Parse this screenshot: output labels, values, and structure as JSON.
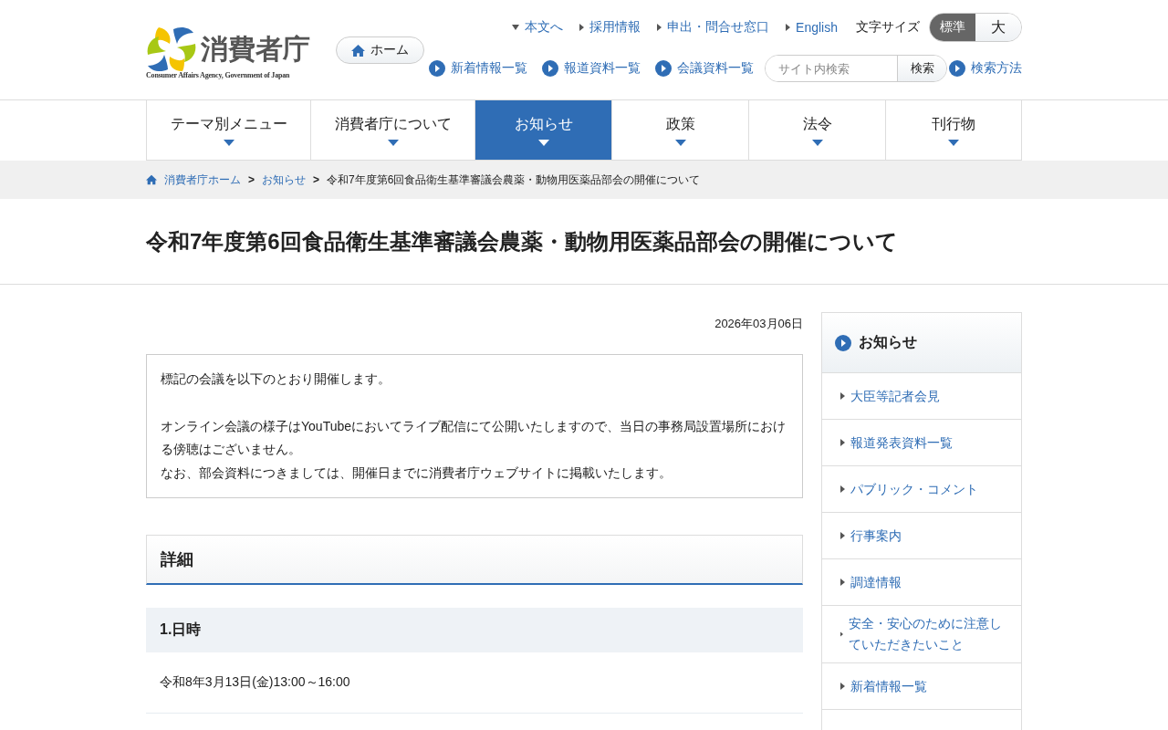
{
  "header": {
    "logo": {
      "name": "消費者庁",
      "subtitle": "Consumer Affairs Agency, Government of Japan"
    },
    "home_button": "ホーム",
    "utility_links": [
      {
        "label": "本文へ",
        "kind": "down"
      },
      {
        "label": "採用情報",
        "kind": "right"
      },
      {
        "label": "申出・問合せ窓口",
        "kind": "right"
      },
      {
        "label": "English",
        "kind": "right"
      }
    ],
    "font_size": {
      "label": "文字サイズ",
      "options": [
        {
          "label": "標準",
          "selected": true
        },
        {
          "label": "大",
          "selected": false
        }
      ]
    },
    "quick_links": [
      "新着情報一覧",
      "報道資料一覧",
      "会議資料一覧"
    ],
    "search": {
      "placeholder": "サイト内検索",
      "button": "検索"
    },
    "search_help": "検索方法"
  },
  "nav": [
    {
      "label": "テーマ別メニュー",
      "selected": false
    },
    {
      "label": "消費者庁について",
      "selected": false
    },
    {
      "label": "お知らせ",
      "selected": true
    },
    {
      "label": "政策",
      "selected": false
    },
    {
      "label": "法令",
      "selected": false
    },
    {
      "label": "刊行物",
      "selected": false
    }
  ],
  "breadcrumb": {
    "separator": ">",
    "links": [
      "消費者庁ホーム",
      "お知らせ"
    ],
    "current": "令和7年度第6回食品衛生基準審議会農薬・動物用医薬品部会の開催について"
  },
  "title": "令和7年度第6回食品衛生基準審議会農薬・動物用医薬品部会の開催について",
  "date": "2026年03月06日",
  "notice": [
    [
      "標記の会議を以下のとおり開催します。"
    ],
    [
      "オンライン会議の様子はYouTubeにおいてライブ配信にて公開いたしますので、当日の事務局設置場所における傍聴はございません。",
      "なお、部会資料につきましては、開催日までに消費者庁ウェブサイトに掲載いたします。"
    ]
  ],
  "details": {
    "heading": "詳細",
    "sections": [
      {
        "heading": "1.日時",
        "body": "令和8年3月13日(金)13:00～16:00"
      }
    ]
  },
  "sidebar": {
    "heading": "お知らせ",
    "items": [
      "大臣等記者会見",
      "報道発表資料一覧",
      "パブリック・コメント",
      "行事案内",
      "調達情報",
      "安全・安心のために注意していただきたいこと",
      "新着情報一覧"
    ]
  }
}
